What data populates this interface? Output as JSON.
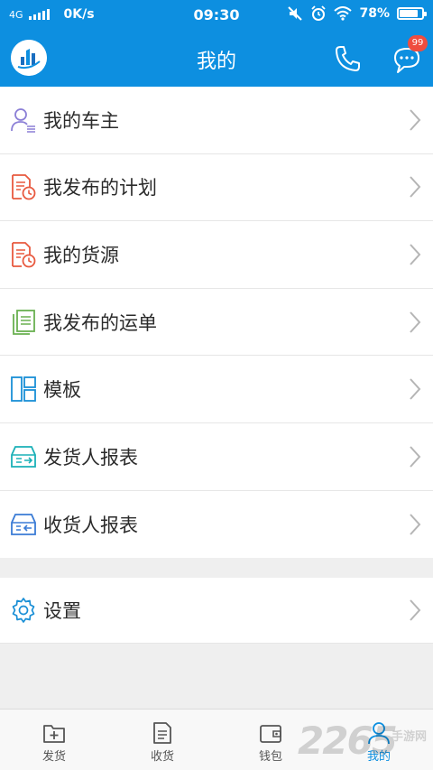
{
  "status_bar": {
    "network": "4G",
    "speed": "0K/s",
    "time": "09:30",
    "battery": "78%",
    "battery_level": 0.78
  },
  "header": {
    "title": "我的",
    "badge": "99"
  },
  "menu": [
    {
      "label": "我的车主",
      "icon": "user-list-icon",
      "color": "#8b7fd6"
    },
    {
      "label": "我发布的计划",
      "icon": "document-clock-icon",
      "color": "#e8593f"
    },
    {
      "label": "我的货源",
      "icon": "document-clock-icon",
      "color": "#e8593f"
    },
    {
      "label": "我发布的运单",
      "icon": "copy-document-icon",
      "color": "#6ab150"
    },
    {
      "label": "模板",
      "icon": "template-layout-icon",
      "color": "#1a8fd6"
    },
    {
      "label": "发货人报表",
      "icon": "outbox-tray-icon",
      "color": "#1ab0b7"
    },
    {
      "label": "收货人报表",
      "icon": "inbox-tray-icon",
      "color": "#3a7bd5"
    }
  ],
  "settings": {
    "label": "设置",
    "icon": "gear-icon"
  },
  "tabbar": [
    {
      "label": "发货",
      "icon": "folder-plus-icon"
    },
    {
      "label": "收货",
      "icon": "document-icon"
    },
    {
      "label": "钱包",
      "icon": "wallet-icon"
    },
    {
      "label": "我的",
      "icon": "person-icon",
      "active": true
    }
  ],
  "watermark": {
    "main": "2265",
    "sub": "手游网"
  },
  "colors": {
    "brand": "#0d8fe0",
    "badge": "#ef4d3f",
    "tab_active": "#0d8fe0"
  }
}
